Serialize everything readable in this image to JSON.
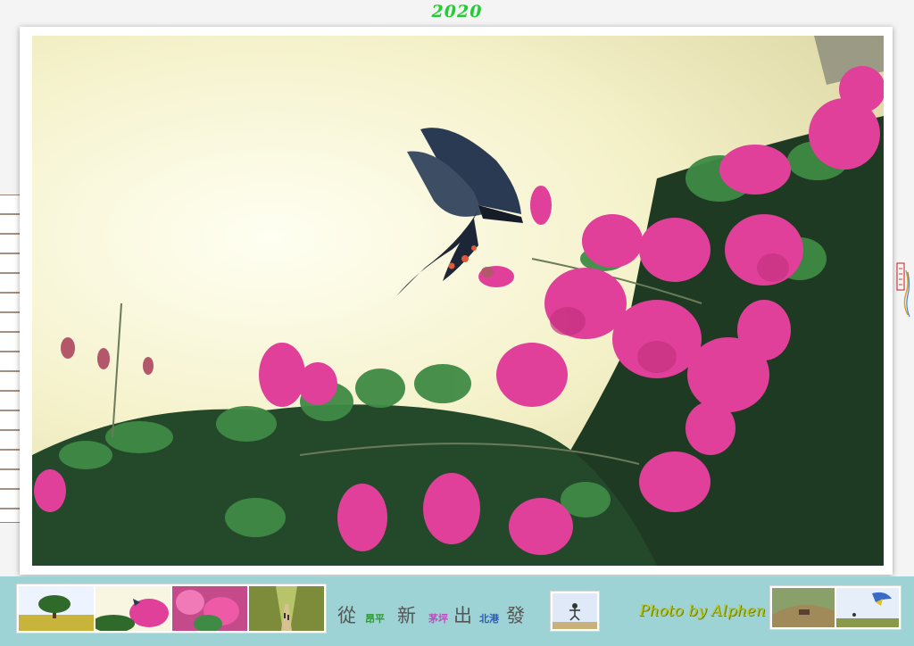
{
  "header": {
    "year": "2020"
  },
  "photo": {
    "subject": "butterfly-on-bougainvillea",
    "colors": {
      "sky": "#f4f1c9",
      "flower": "#e0409a",
      "leaf": "#2f7a3a",
      "butterfly": "#2a3a52"
    }
  },
  "footer": {
    "motto": {
      "c1": "從",
      "s1": "昂平",
      "c2": "新",
      "s2": "茅坪",
      "c3": "出",
      "s3": "北港",
      "c4": "發"
    },
    "credit": "Photo by Alphen",
    "colors": {
      "bar": "#9ed3d5",
      "s1": "#2c9a2c",
      "s2": "#c04ac0",
      "s3": "#2a5ac0"
    }
  }
}
